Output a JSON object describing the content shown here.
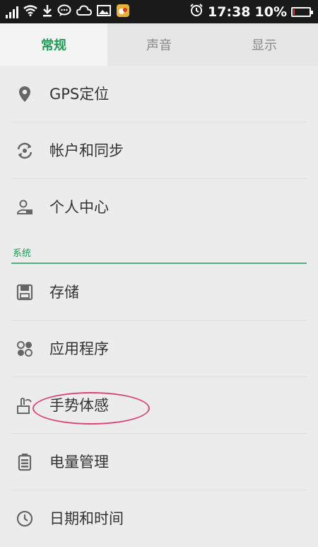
{
  "status_bar": {
    "time": "17:38",
    "battery": "10%",
    "battery_level": 0.1,
    "icons": [
      "signal-icon",
      "wifi-icon",
      "download-icon",
      "chat-icon",
      "cloud-icon",
      "image-icon",
      "app-icon",
      "alarm-icon",
      "battery-icon"
    ]
  },
  "tabs": [
    {
      "label": "常规",
      "active": true
    },
    {
      "label": "声音",
      "active": false
    },
    {
      "label": "显示",
      "active": false
    }
  ],
  "items_general": [
    {
      "label": "GPS定位",
      "icon": "location-icon"
    },
    {
      "label": "帐户和同步",
      "icon": "sync-icon"
    },
    {
      "label": "个人中心",
      "icon": "person-icon"
    }
  ],
  "section": {
    "label": "系统"
  },
  "items_system": [
    {
      "label": "存储",
      "icon": "storage-icon"
    },
    {
      "label": "应用程序",
      "icon": "apps-icon"
    },
    {
      "label": "手势体感",
      "icon": "gesture-icon"
    },
    {
      "label": "电量管理",
      "icon": "battery-manage-icon"
    },
    {
      "label": "日期和时间",
      "icon": "clock-icon"
    }
  ],
  "colors": {
    "accent": "#1f9d55",
    "highlight": "#d9457a"
  }
}
